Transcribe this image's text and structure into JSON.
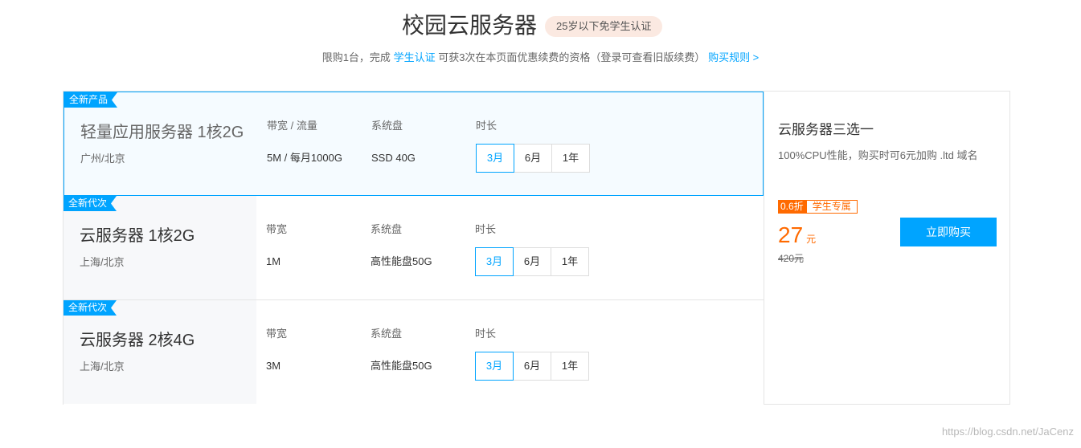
{
  "header": {
    "title": "校园云服务器",
    "badge": "25岁以下免学生认证"
  },
  "subtitle": {
    "prefix": "限购1台，完成",
    "link1": "学生认证",
    "middle": "可获3次在本页面优惠续费的资格（登录可查看旧版续费）",
    "link2": "购买规则 >"
  },
  "labels": {
    "bandwidth_flow": "带宽 / 流量",
    "bandwidth": "带宽",
    "disk": "系统盘",
    "duration": "时长"
  },
  "duration_options": [
    "3月",
    "6月",
    "1年"
  ],
  "products": [
    {
      "tag": "全新产品",
      "name": "轻量应用服务器 1核2G",
      "region": "广州/北京",
      "bandwidth": "5M / 每月1000G",
      "disk": "SSD 40G",
      "selected_duration": "3月"
    },
    {
      "tag": "全新代次",
      "name": "云服务器 1核2G",
      "region": "上海/北京",
      "bandwidth": "1M",
      "disk": "高性能盘50G",
      "selected_duration": "3月"
    },
    {
      "tag": "全新代次",
      "name": "云服务器 2核4G",
      "region": "上海/北京",
      "bandwidth": "3M",
      "disk": "高性能盘50G",
      "selected_duration": "3月"
    }
  ],
  "side": {
    "title": "云服务器三选一",
    "desc": "100%CPU性能，购买时可6元加购 .ltd 域名",
    "discount": "0.6折",
    "discount_tag": "学生专属",
    "price": "27",
    "price_unit": "元",
    "original_price": "420元",
    "buy_label": "立即购买"
  },
  "watermark": "https://blog.csdn.net/JaCenz",
  "colors": {
    "accent": "#00a4ff",
    "price": "#ff6a00",
    "badge_bg": "#fbe9e1"
  }
}
